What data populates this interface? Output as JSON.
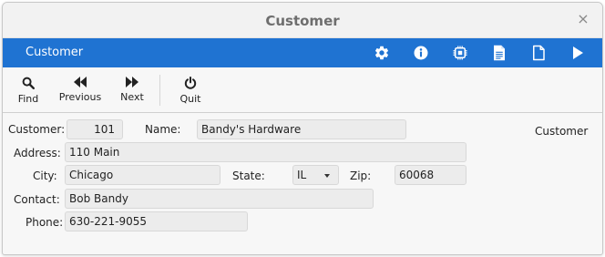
{
  "window": {
    "title": "Customer",
    "close_glyph": "×"
  },
  "appbar": {
    "title": "Customer",
    "bg_color": "#1f73d2",
    "icons": [
      "gear-icon",
      "info-icon",
      "chip-icon",
      "document-text-icon",
      "document-blank-icon",
      "play-icon"
    ]
  },
  "toolbar": {
    "find_label": "Find",
    "previous_label": "Previous",
    "next_label": "Next",
    "quit_label": "Quit"
  },
  "form": {
    "side_title": "Customer",
    "customer_label": "Customer:",
    "customer_value": "101",
    "name_label": "Name:",
    "name_value": "Bandy's Hardware",
    "address_label": "Address:",
    "address_value": "110 Main",
    "city_label": "City:",
    "city_value": "Chicago",
    "state_label": "State:",
    "state_value": "IL",
    "zip_label": "Zip:",
    "zip_value": "60068",
    "contact_label": "Contact:",
    "contact_value": "Bob Bandy",
    "phone_label": "Phone:",
    "phone_value": "630-221-9055"
  }
}
